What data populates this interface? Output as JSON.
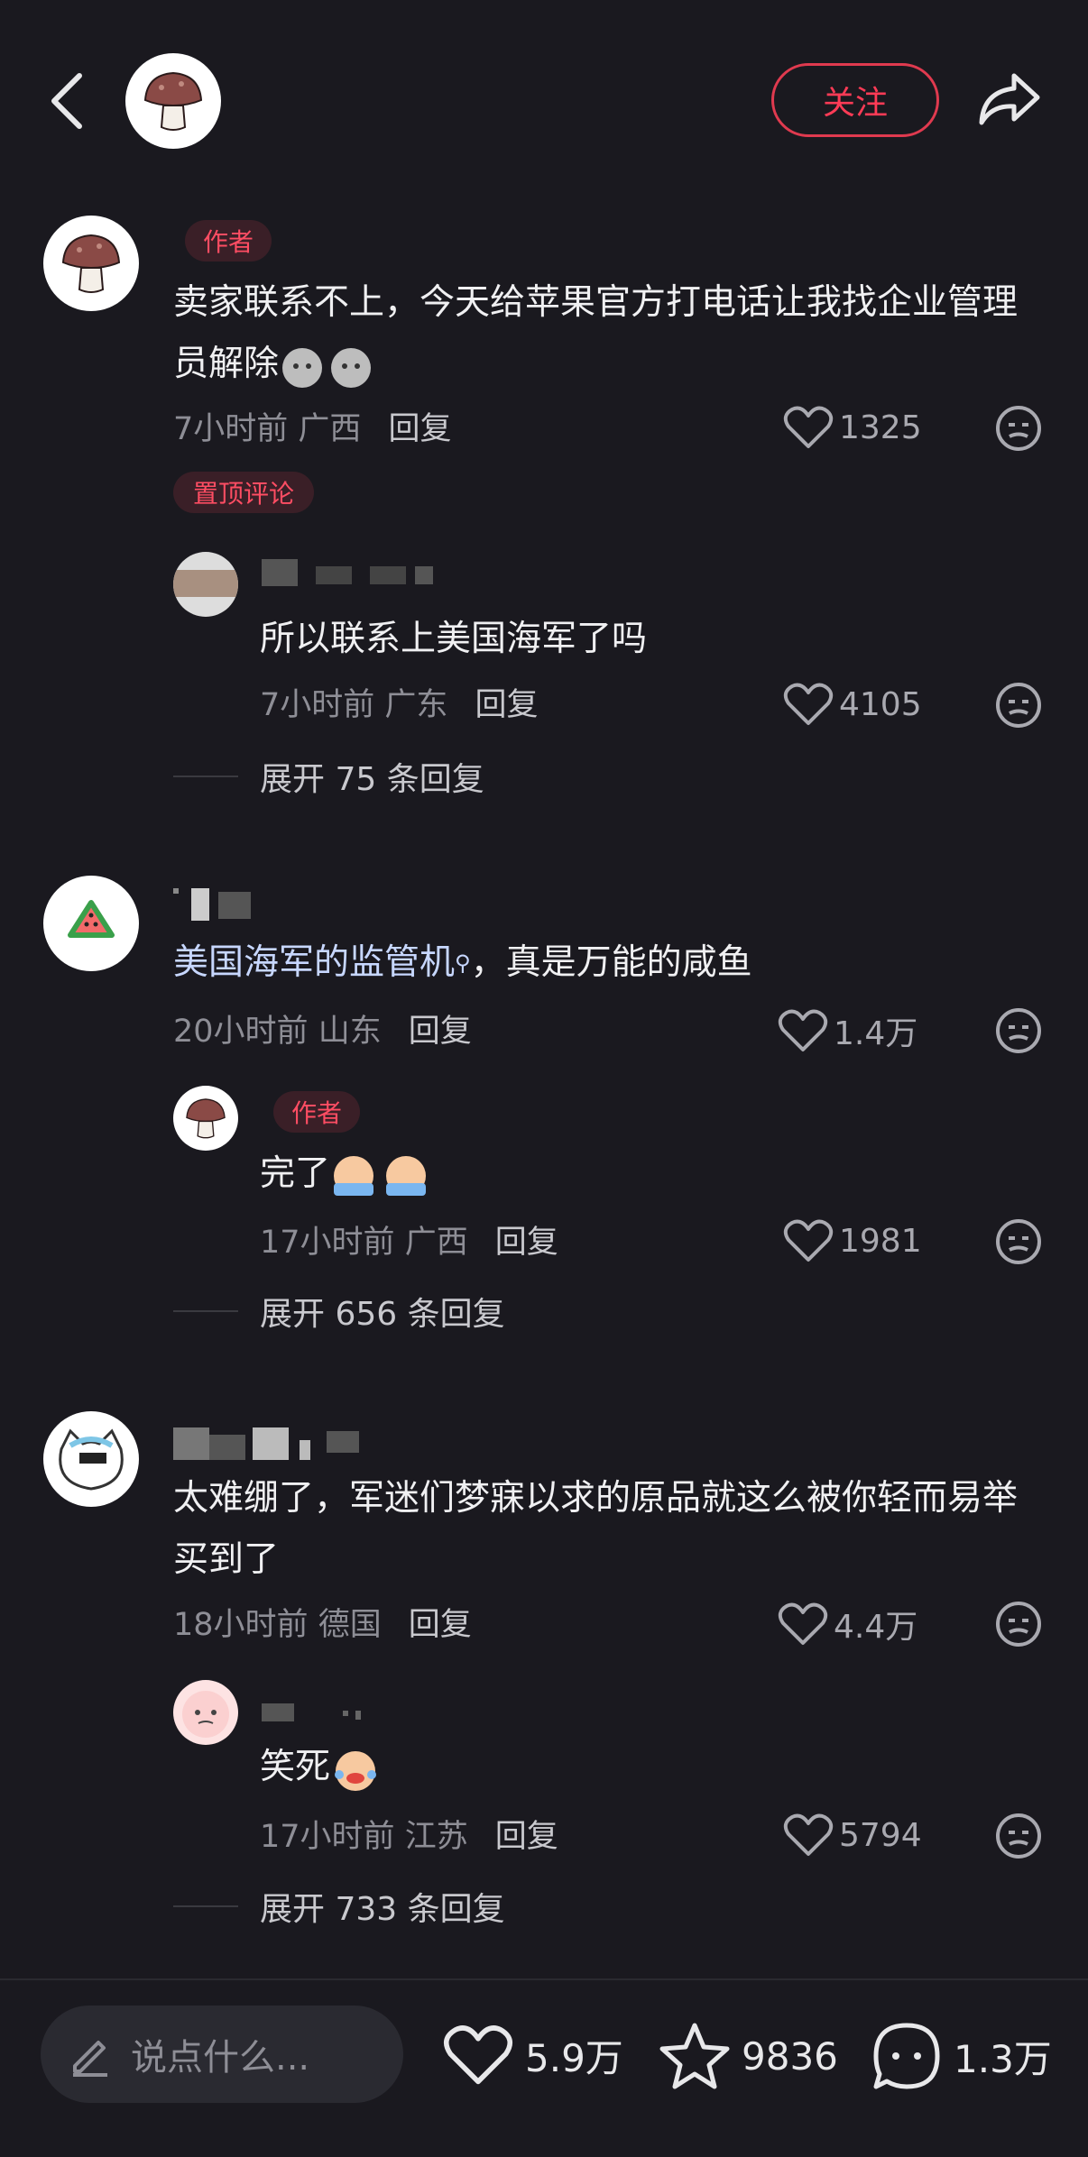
{
  "header": {
    "follow_label": "关注"
  },
  "comments": [
    {
      "author_tag": "作者",
      "text": "卖家联系不上，今天给苹果官方打电话让我找企业管理员解除",
      "time": "7小时前",
      "location": "广西",
      "reply_label": "回复",
      "likes": "1325",
      "pinned_tag": "置顶评论",
      "replies": [
        {
          "text": "所以联系上美国海军了吗",
          "time": "7小时前",
          "location": "广东",
          "reply_label": "回复",
          "likes": "4105"
        }
      ],
      "expand_label": "展开 75 条回复"
    },
    {
      "text_link": "美国海军的监管机",
      "text_rest": "，真是万能的咸鱼",
      "time": "20小时前",
      "location": "山东",
      "reply_label": "回复",
      "likes": "1.4万",
      "replies": [
        {
          "author_tag": "作者",
          "text": "完了",
          "time": "17小时前",
          "location": "广西",
          "reply_label": "回复",
          "likes": "1981"
        }
      ],
      "expand_label": "展开 656 条回复"
    },
    {
      "text": "太难绷了，军迷们梦寐以求的原品就这么被你轻而易举买到了",
      "time": "18小时前",
      "location": "德国",
      "reply_label": "回复",
      "likes": "4.4万",
      "replies": [
        {
          "text": "笑死",
          "time": "17小时前",
          "location": "江苏",
          "reply_label": "回复",
          "likes": "5794"
        }
      ],
      "expand_label": "展开 733 条回复"
    }
  ],
  "bottom_bar": {
    "input_placeholder": "说点什么...",
    "likes": "5.9万",
    "favorites": "9836",
    "comments": "1.3万"
  },
  "colors": {
    "background": "#1a191f",
    "accent": "#ff3b56",
    "link": "#c7d7ff"
  }
}
